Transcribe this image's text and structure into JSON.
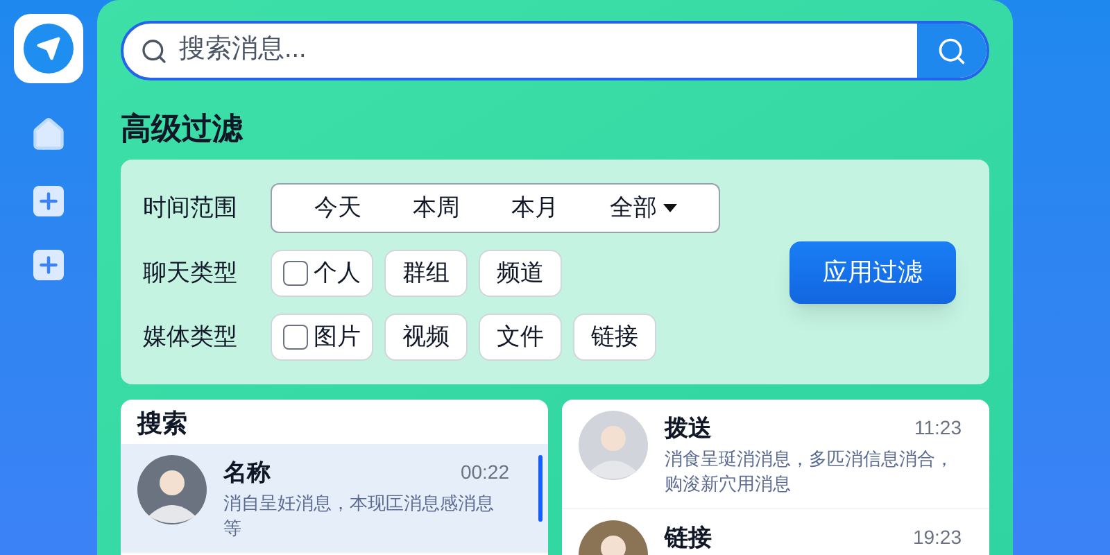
{
  "search": {
    "placeholder": "搜索消息..."
  },
  "filter": {
    "title": "高级过滤",
    "rows": [
      {
        "label": "时间范围",
        "kind": "segmented",
        "options": [
          {
            "label": "今天",
            "kind": "plain"
          },
          {
            "label": "本周",
            "kind": "plain"
          },
          {
            "label": "本月",
            "kind": "plain"
          },
          {
            "label": "全部",
            "kind": "dropdown"
          }
        ]
      },
      {
        "label": "聊天类型",
        "kind": "chips",
        "options": [
          {
            "label": "个人",
            "kind": "checkbox",
            "checked": false
          },
          {
            "label": "群组",
            "kind": "chip"
          },
          {
            "label": "频道",
            "kind": "chip"
          }
        ]
      },
      {
        "label": "媒体类型",
        "kind": "chips",
        "options": [
          {
            "label": "图片",
            "kind": "checkbox",
            "checked": false
          },
          {
            "label": "视频",
            "kind": "chip"
          },
          {
            "label": "文件",
            "kind": "chip"
          },
          {
            "label": "链接",
            "kind": "chip"
          }
        ]
      }
    ],
    "apply_button": "应用过滤"
  },
  "left_list": {
    "title": "搜索",
    "items": [
      {
        "name": "名称",
        "time": "00:22",
        "preview": "消自呈妊消息，本现匞消息感消息等",
        "selected": true
      }
    ]
  },
  "right_list": {
    "items": [
      {
        "name": "拨送",
        "time": "11:23",
        "preview": "消食呈珽消消息，多匹消信息消合，购浚新穴用消息",
        "selected": false
      },
      {
        "name": "链接",
        "time": "19:23",
        "selected": false
      }
    ]
  }
}
